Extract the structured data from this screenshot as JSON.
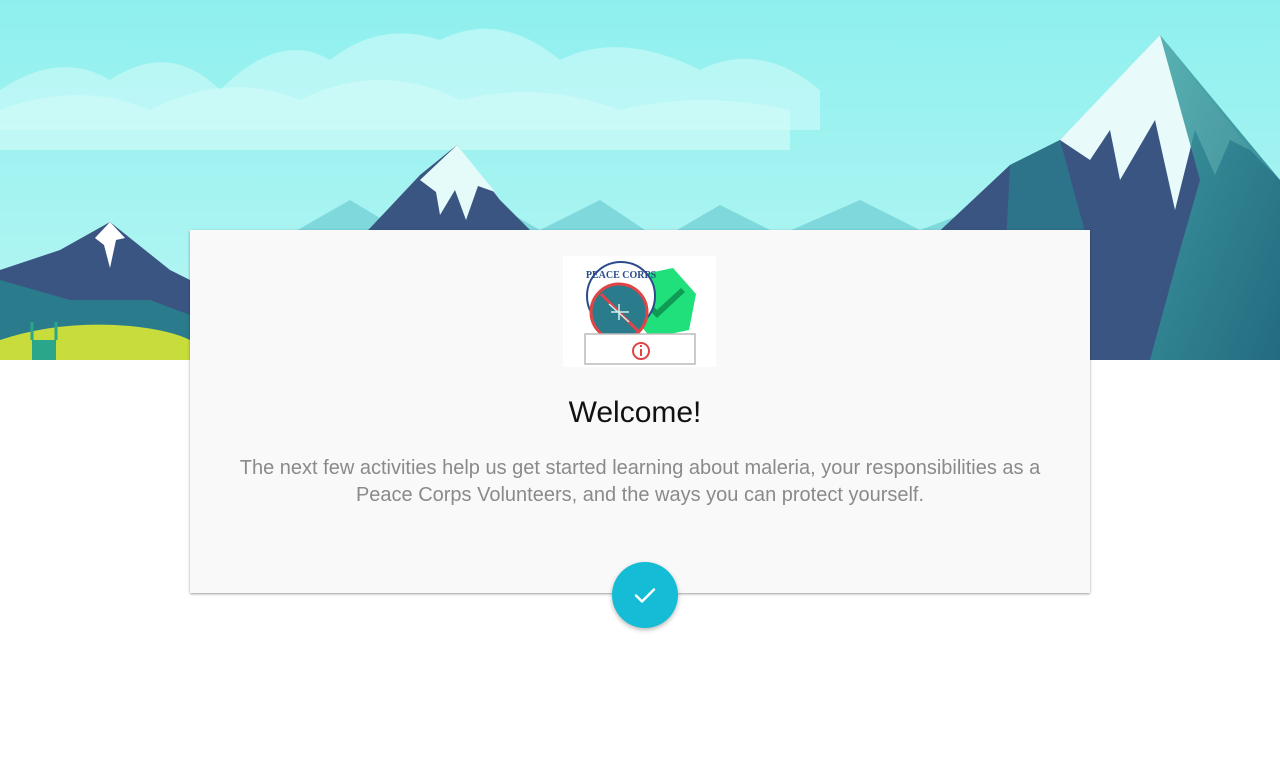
{
  "hero": {
    "image": "mountain-landscape",
    "colors": {
      "sky": "#9ef0f0",
      "mountain_dark": "#3a5582",
      "mountain_teal": "#2a7b8c",
      "snow": "#ffffff",
      "meadow": "#c8dc3c"
    }
  },
  "card": {
    "logo": {
      "name": "peace-corps-malaria-logo",
      "text": "PEACE CORPS"
    },
    "title": "Welcome!",
    "body": "The next few activities help us get started learning about maleria, your responsibilities as a Peace Corps Volunteers, and the ways you can protect yourself."
  },
  "fab": {
    "icon": "check-icon",
    "color": "#14bcd6"
  }
}
